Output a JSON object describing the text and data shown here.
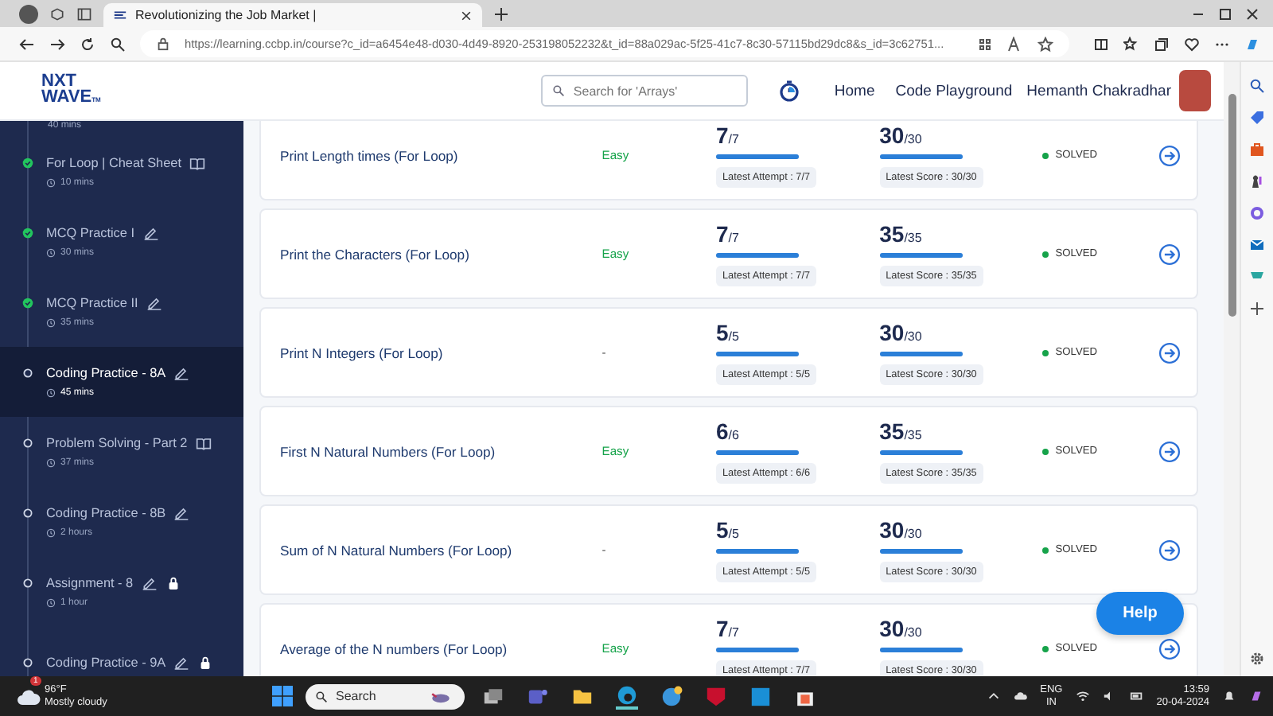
{
  "browser": {
    "tab_title": "Revolutionizing the Job Market |",
    "url": "https://learning.ccbp.in/course?c_id=a6454e48-d030-4d49-8920-253198052232&t_id=88a029ac-5f25-41c7-8c30-57115bd29dc8&s_id=3c62751..."
  },
  "header": {
    "logo_top": "NXT",
    "logo_bottom": "WAVE",
    "logo_suffix": "TM",
    "search": {
      "placeholder": "Search for 'Arrays'"
    },
    "nav": [
      "Home",
      "Code Playground"
    ],
    "user": "Hemanth Chakradhar"
  },
  "sidebar": {
    "top_partial_duration": "40 mins",
    "items": [
      {
        "title": "For Loop | Cheat Sheet",
        "kind": "reading",
        "duration": "10 mins",
        "completed": true,
        "selected": false,
        "locked": false
      },
      {
        "title": "MCQ Practice I",
        "kind": "practice",
        "duration": "30 mins",
        "completed": true,
        "selected": false,
        "locked": false
      },
      {
        "title": "MCQ Practice II",
        "kind": "practice",
        "duration": "35 mins",
        "completed": true,
        "selected": false,
        "locked": false
      },
      {
        "title": "Coding Practice - 8A",
        "kind": "practice",
        "duration": "45 mins",
        "completed": false,
        "selected": true,
        "locked": false
      },
      {
        "title": "Problem Solving - Part 2",
        "kind": "reading",
        "duration": "37 mins",
        "completed": false,
        "selected": false,
        "locked": false
      },
      {
        "title": "Coding Practice - 8B",
        "kind": "practice",
        "duration": "2 hours",
        "completed": false,
        "selected": false,
        "locked": false
      },
      {
        "title": "Assignment - 8",
        "kind": "practice",
        "duration": "1 hour",
        "completed": false,
        "selected": false,
        "locked": true
      },
      {
        "title": "Coding Practice - 9A",
        "kind": "practice",
        "completed": false,
        "selected": false,
        "locked": true
      }
    ]
  },
  "questions": [
    {
      "title": "Print Length times (For Loop)",
      "difficulty": "Easy",
      "attempt": "7",
      "attempt_total": "/7",
      "attempt_bar": {
        "level": 1
      },
      "attempt_label": "Latest Attempt : 7/7",
      "score": "30",
      "score_total": "/30",
      "score_bar": {
        "level": 1
      },
      "score_label": "Latest Score : 30/30",
      "status": "SOLVED"
    },
    {
      "title": "Print the Characters (For Loop)",
      "difficulty": "Easy",
      "attempt": "7",
      "attempt_total": "/7",
      "attempt_bar": {
        "level": 1
      },
      "attempt_label": "Latest Attempt : 7/7",
      "score": "35",
      "score_total": "/35",
      "score_bar": {
        "level": 1
      },
      "score_label": "Latest Score : 35/35",
      "status": "SOLVED"
    },
    {
      "title": "Print N Integers (For Loop)",
      "difficulty": "-",
      "attempt": "5",
      "attempt_total": "/5",
      "attempt_bar": {
        "level": 1
      },
      "attempt_label": "Latest Attempt : 5/5",
      "score": "30",
      "score_total": "/30",
      "score_bar": {
        "level": 1
      },
      "score_label": "Latest Score : 30/30",
      "status": "SOLVED"
    },
    {
      "title": "First N Natural Numbers (For Loop)",
      "difficulty": "Easy",
      "attempt": "6",
      "attempt_total": "/6",
      "attempt_bar": {
        "level": 1
      },
      "attempt_label": "Latest Attempt : 6/6",
      "score": "35",
      "score_total": "/35",
      "score_bar": {
        "level": 1
      },
      "score_label": "Latest Score : 35/35",
      "status": "SOLVED"
    },
    {
      "title": "Sum of N Natural Numbers (For Loop)",
      "difficulty": "-",
      "attempt": "5",
      "attempt_total": "/5",
      "attempt_bar": {
        "level": 1
      },
      "attempt_label": "Latest Attempt : 5/5",
      "score": "30",
      "score_total": "/30",
      "score_bar": {
        "level": 1
      },
      "score_label": "Latest Score : 30/30",
      "status": "SOLVED"
    },
    {
      "title": "Average of the N numbers (For Loop)",
      "difficulty": "Easy",
      "attempt": "7",
      "attempt_total": "/7",
      "attempt_bar": {
        "level": 1
      },
      "attempt_label": "Latest Attempt : 7/7",
      "score": "30",
      "score_total": "/30",
      "score_bar": {
        "level": 1
      },
      "score_label": "Latest Score : 30/30",
      "status": "SOLVED"
    }
  ],
  "help_button": "Help",
  "taskbar": {
    "weather_badge": "1",
    "temperature": "96°F",
    "weather": "Mostly cloudy",
    "search": "Search",
    "language": "ENG",
    "region": "IN",
    "time": "13:59",
    "date": "20-04-2024"
  }
}
